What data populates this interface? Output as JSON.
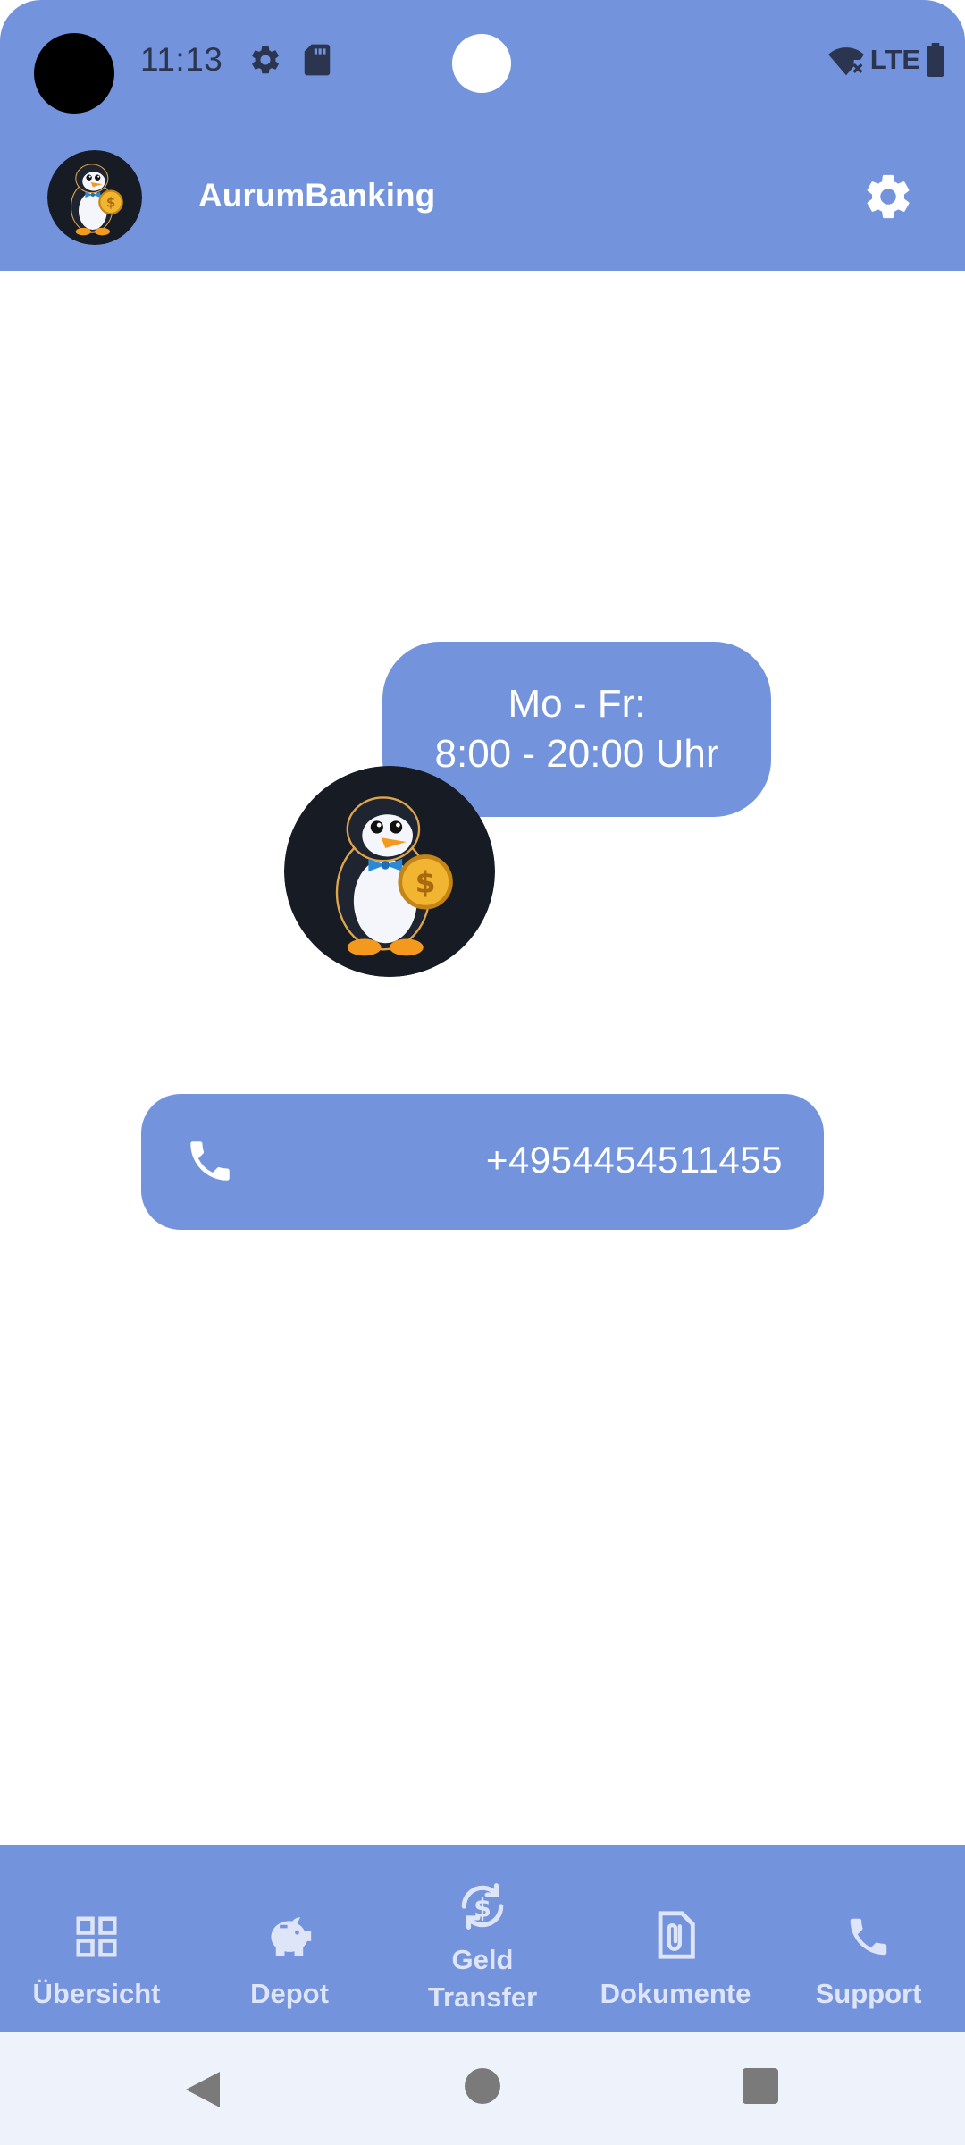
{
  "status_bar": {
    "time": "11:13",
    "network": "LTE",
    "icons": [
      "settings-icon",
      "sd-card-icon",
      "wifi-off-icon",
      "battery-icon"
    ]
  },
  "app_bar": {
    "title": "AurumBanking",
    "logo": "penguin-mascot-icon",
    "settings_icon": "gear-icon"
  },
  "support": {
    "hours_line1": "Mo - Fr:",
    "hours_line2": "8:00 - 20:00 Uhr",
    "phone_icon": "phone-icon",
    "phone_number": "+4954454511455"
  },
  "bottom_nav": {
    "items": [
      {
        "label": "Übersicht",
        "icon": "grid-icon"
      },
      {
        "label": "Depot",
        "icon": "piggy-bank-icon"
      },
      {
        "label_line1": "Geld",
        "label_line2": "Transfer",
        "icon": "money-exchange-icon"
      },
      {
        "label": "Dokumente",
        "icon": "paperclip-document-icon"
      },
      {
        "label": "Support",
        "icon": "phone-icon"
      }
    ]
  },
  "system_nav": [
    "back-icon",
    "home-icon",
    "recents-icon"
  ],
  "colors": {
    "primary": "#7393dc",
    "status_text": "#2b3550",
    "nav_label": "#dfe5f8",
    "system_nav_bg": "#eef2fa",
    "mascot_bg": "#161b24"
  }
}
